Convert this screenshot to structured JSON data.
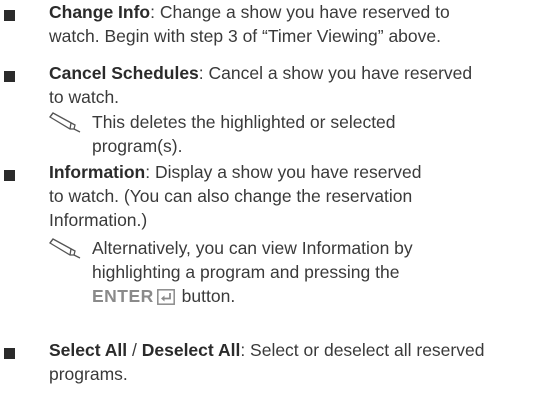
{
  "items": [
    {
      "term": "Change Info",
      "line1": ": Change a show you have reserved to",
      "line2": "watch. Begin with step 3 of “Timer Viewing” above."
    },
    {
      "term": "Cancel Schedules",
      "line1": ": Cancel a show you have reserved",
      "line2": "to watch.",
      "note": {
        "icon": "note-pencil-icon",
        "line1": "This deletes the highlighted or selected",
        "line2": "program(s)."
      }
    },
    {
      "term": "Information",
      "line1": ": Display a show you have reserved",
      "line2": "to watch. (You can also change the reservation",
      "line3": "Information.)",
      "note": {
        "icon": "note-pencil-icon",
        "line1": "Alternatively, you can view Information by",
        "line2": "highlighting a program and pressing the",
        "enter_label": "ENTER",
        "enter_icon": "enter-key-icon",
        "line3_suffix": " button."
      }
    },
    {
      "term": "Select All",
      "separator": " / ",
      "term2": "Deselect All",
      "line1": ": Select or deselect all reserved",
      "line2": "programs."
    }
  ],
  "colors": {
    "text": "#3a3a3a",
    "bullet": "#2b2b2b",
    "enter": "#8a8a8a"
  }
}
